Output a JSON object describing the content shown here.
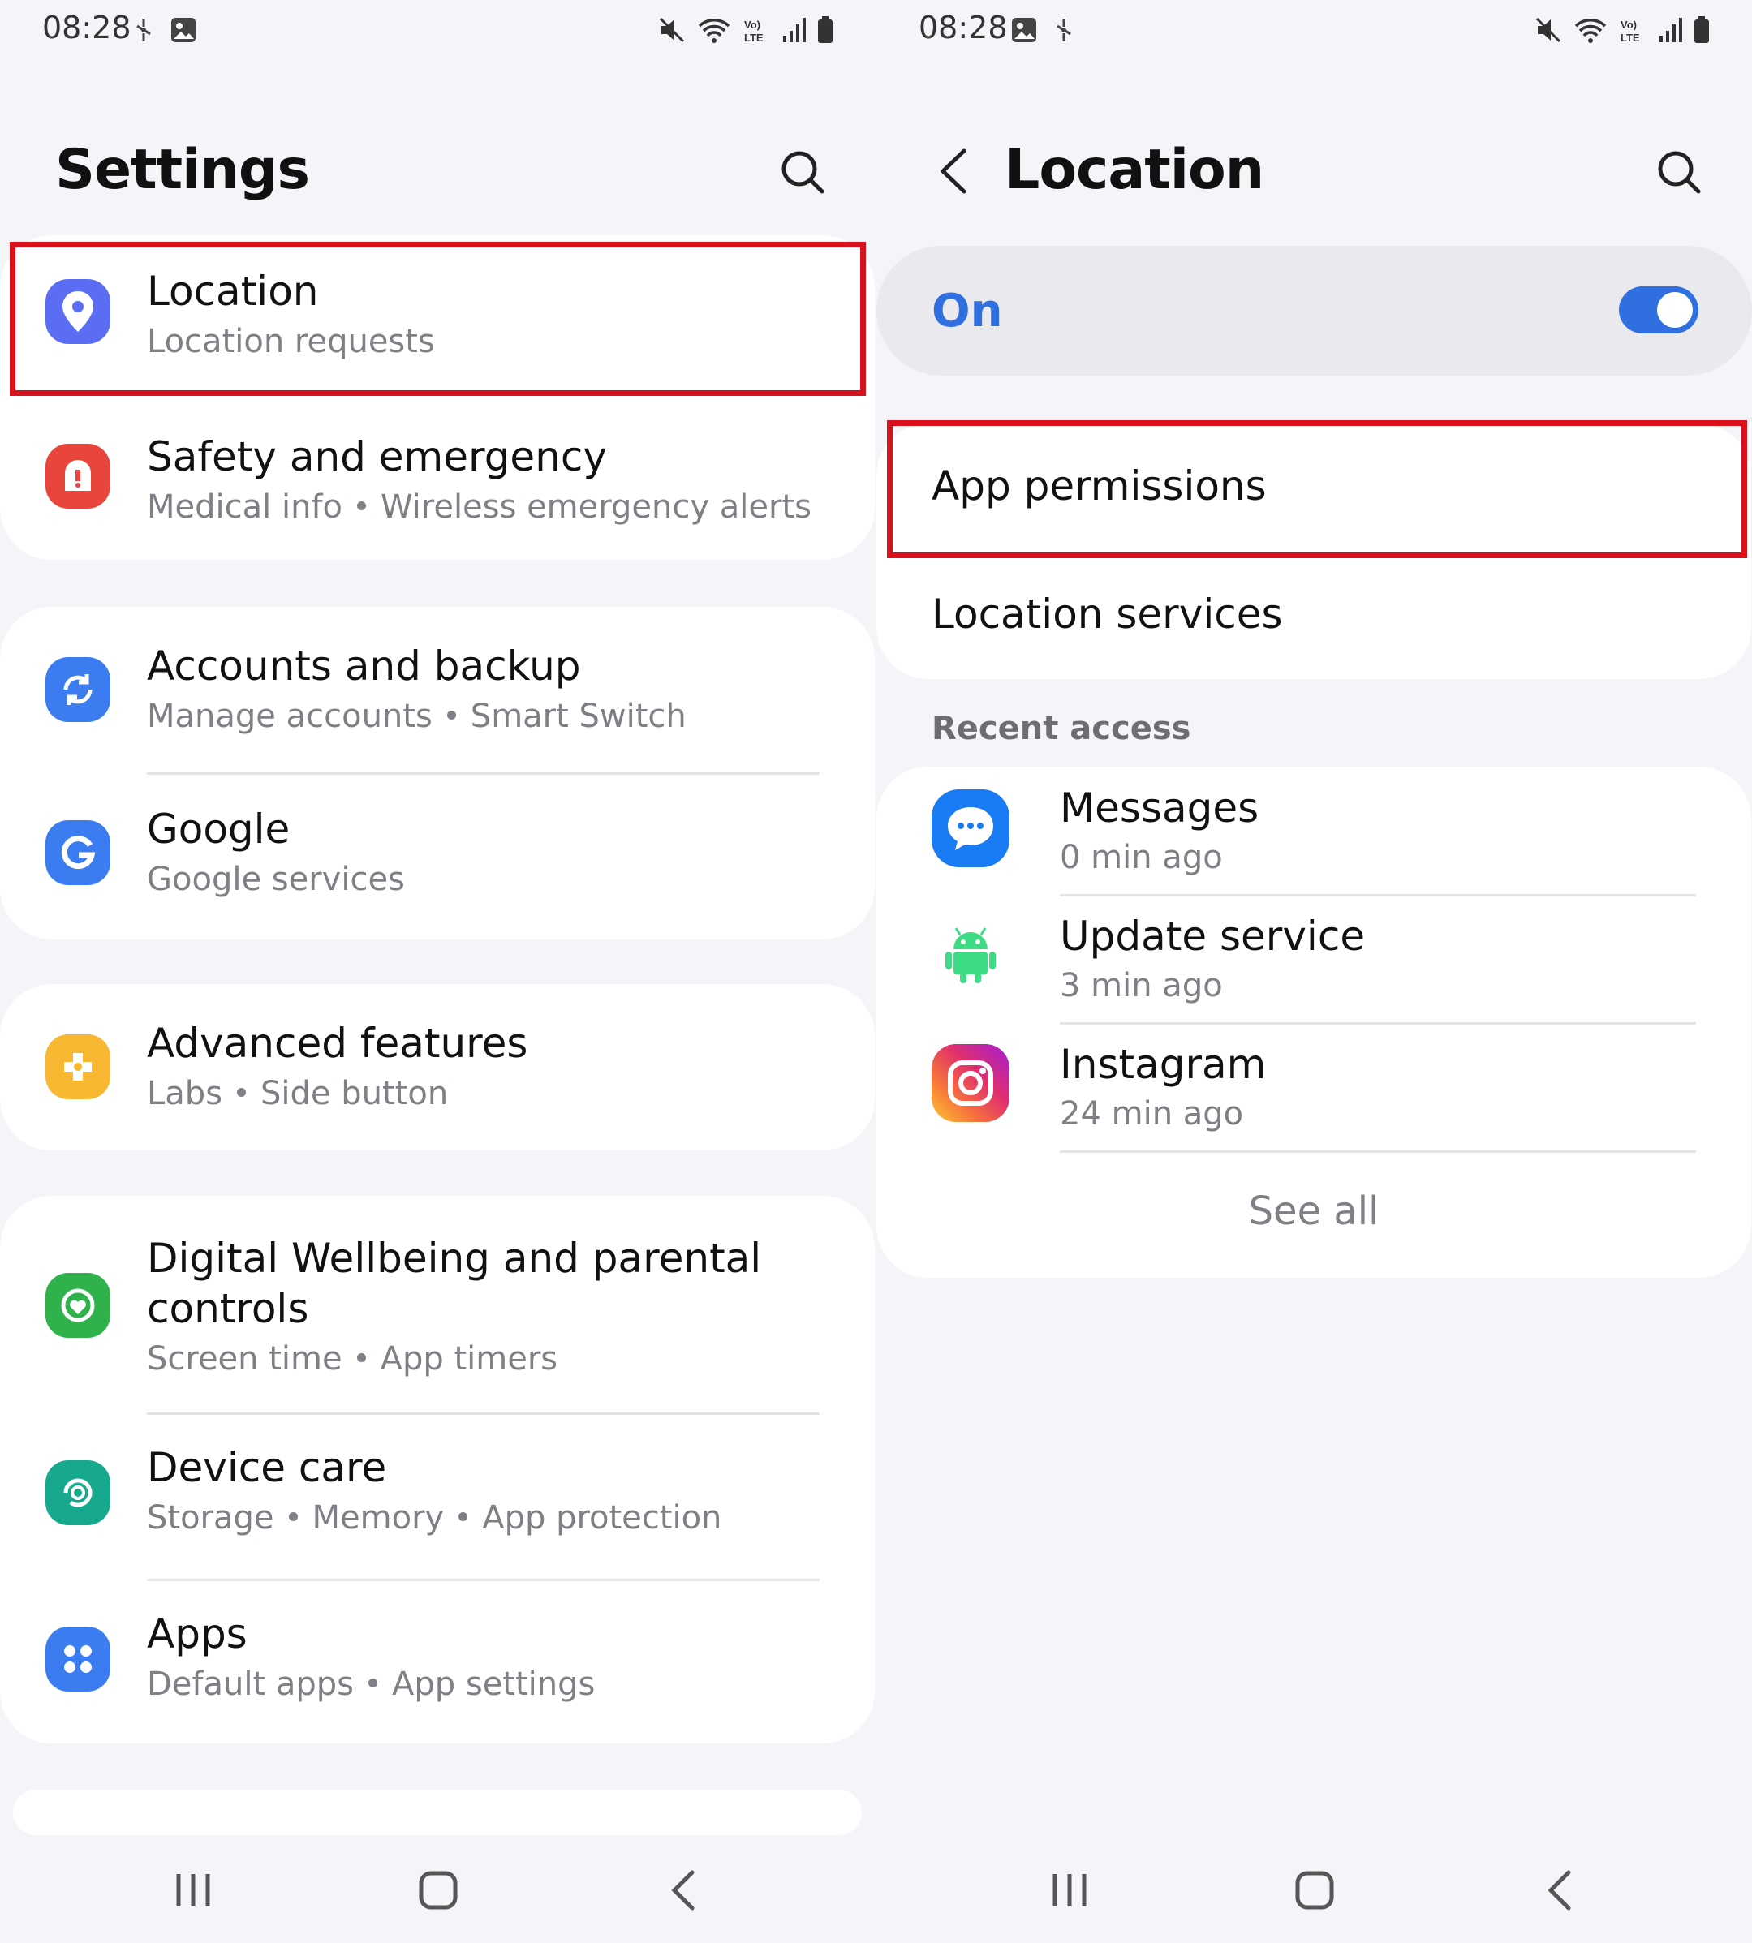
{
  "left": {
    "status": {
      "time": "08:28"
    },
    "header": {
      "title": "Settings",
      "search_icon": "search-icon"
    },
    "items": [
      {
        "title": "Location",
        "subtitle": "Location requests",
        "icon": "location-pin-icon",
        "color": "#5b6df2"
      },
      {
        "title": "Safety and emergency",
        "sub": [
          "Medical info",
          "Wireless emergency alerts"
        ],
        "icon": "alert-icon",
        "color": "#e8453c"
      },
      {
        "title": "Accounts and backup",
        "sub": [
          "Manage accounts",
          "Smart Switch"
        ],
        "icon": "sync-icon",
        "color": "#3b7df0"
      },
      {
        "title": "Google",
        "subtitle": "Google services",
        "icon": "google-icon",
        "color": "#3b7df0"
      },
      {
        "title": "Advanced features",
        "sub": [
          "Labs",
          "Side button"
        ],
        "icon": "puzzle-icon",
        "color": "#f7b731"
      },
      {
        "title_line1": "Digital Wellbeing and parental",
        "title_line2": "controls",
        "sub": [
          "Screen time",
          "App timers"
        ],
        "icon": "wellbeing-icon",
        "color": "#2fb24b"
      },
      {
        "title": "Device care",
        "sub": [
          "Storage",
          "Memory",
          "App protection"
        ],
        "icon": "device-care-icon",
        "color": "#17a98d"
      },
      {
        "title": "Apps",
        "sub": [
          "Default apps",
          "App settings"
        ],
        "icon": "apps-grid-icon",
        "color": "#3b7df0"
      }
    ]
  },
  "right": {
    "status": {
      "time": "08:28"
    },
    "header": {
      "title": "Location",
      "back_icon": "back-arrow-icon",
      "search_icon": "search-icon"
    },
    "toggle": {
      "label": "On",
      "state": "on",
      "color": "#2f6fe0"
    },
    "menu": {
      "app_permissions": "App permissions",
      "location_services": "Location services"
    },
    "recent": {
      "label": "Recent access",
      "apps": [
        {
          "name": "Messages",
          "time": "0 min ago",
          "icon": "messages-icon"
        },
        {
          "name": "Update service",
          "time": "3 min ago",
          "icon": "android-icon"
        },
        {
          "name": "Instagram",
          "time": "24 min ago",
          "icon": "instagram-icon"
        }
      ],
      "see_all": "See all"
    }
  },
  "highlight_color": "#d8121d"
}
